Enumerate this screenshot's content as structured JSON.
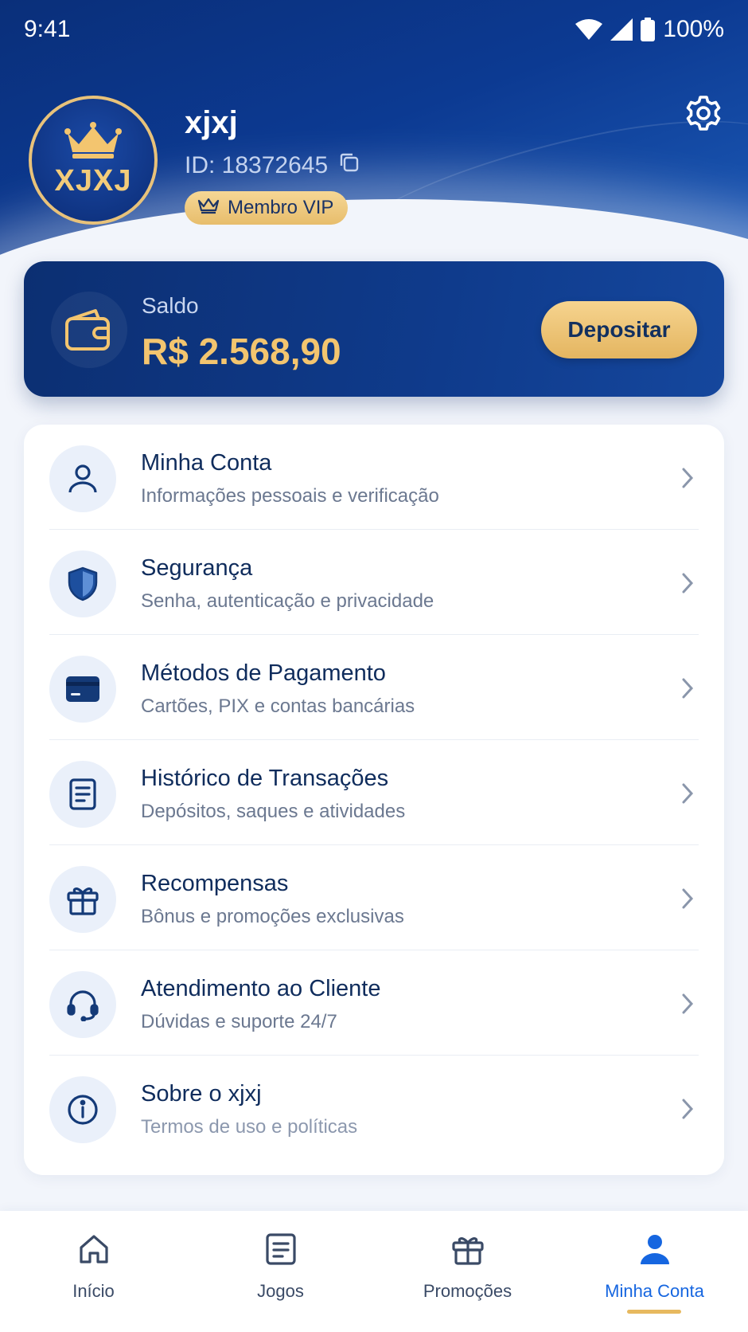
{
  "status_bar": {
    "time": "9:41",
    "battery": "100%"
  },
  "profile": {
    "avatar_text": "XJXJ",
    "name": "xjxj",
    "id_text": "ID: 18372645",
    "badge": "Membro VIP"
  },
  "balance": {
    "label": "Saldo",
    "value": "R$ 2.568,90",
    "deposit_label": "Depositar"
  },
  "menu": {
    "items": [
      {
        "title": "Minha Conta",
        "subtitle": "Informações pessoais e verificação",
        "icon": "user-icon"
      },
      {
        "title": "Segurança",
        "subtitle": "Senha, autenticação e privacidade",
        "icon": "shield-icon"
      },
      {
        "title": "Métodos de Pagamento",
        "subtitle": "Cartões, PIX e contas bancárias",
        "icon": "credit-card-icon"
      },
      {
        "title": "Histórico de Transações",
        "subtitle": "Depósitos, saques e atividades",
        "icon": "document-icon"
      },
      {
        "title": "Recompensas",
        "subtitle": "Bônus e promoções exclusivas",
        "icon": "gift-icon"
      },
      {
        "title": "Atendimento ao Cliente",
        "subtitle": "Dúvidas e suporte 24/7",
        "icon": "headset-icon"
      },
      {
        "title": "Sobre o xjxj",
        "subtitle": "Termos de uso e políticas",
        "icon": "info-icon"
      }
    ]
  },
  "bottom_nav": {
    "items": [
      {
        "label": "Início",
        "icon": "home-icon"
      },
      {
        "label": "Jogos",
        "icon": "games-icon"
      },
      {
        "label": "Promoções",
        "icon": "gift-icon"
      },
      {
        "label": "Minha Conta",
        "icon": "user-icon"
      }
    ],
    "active": "Minha Conta"
  },
  "colors": {
    "primary_dark": "#0c2f72",
    "accent_gold": "#e7bd6c",
    "active_blue": "#1666e0",
    "icon_blue": "#143a78"
  }
}
